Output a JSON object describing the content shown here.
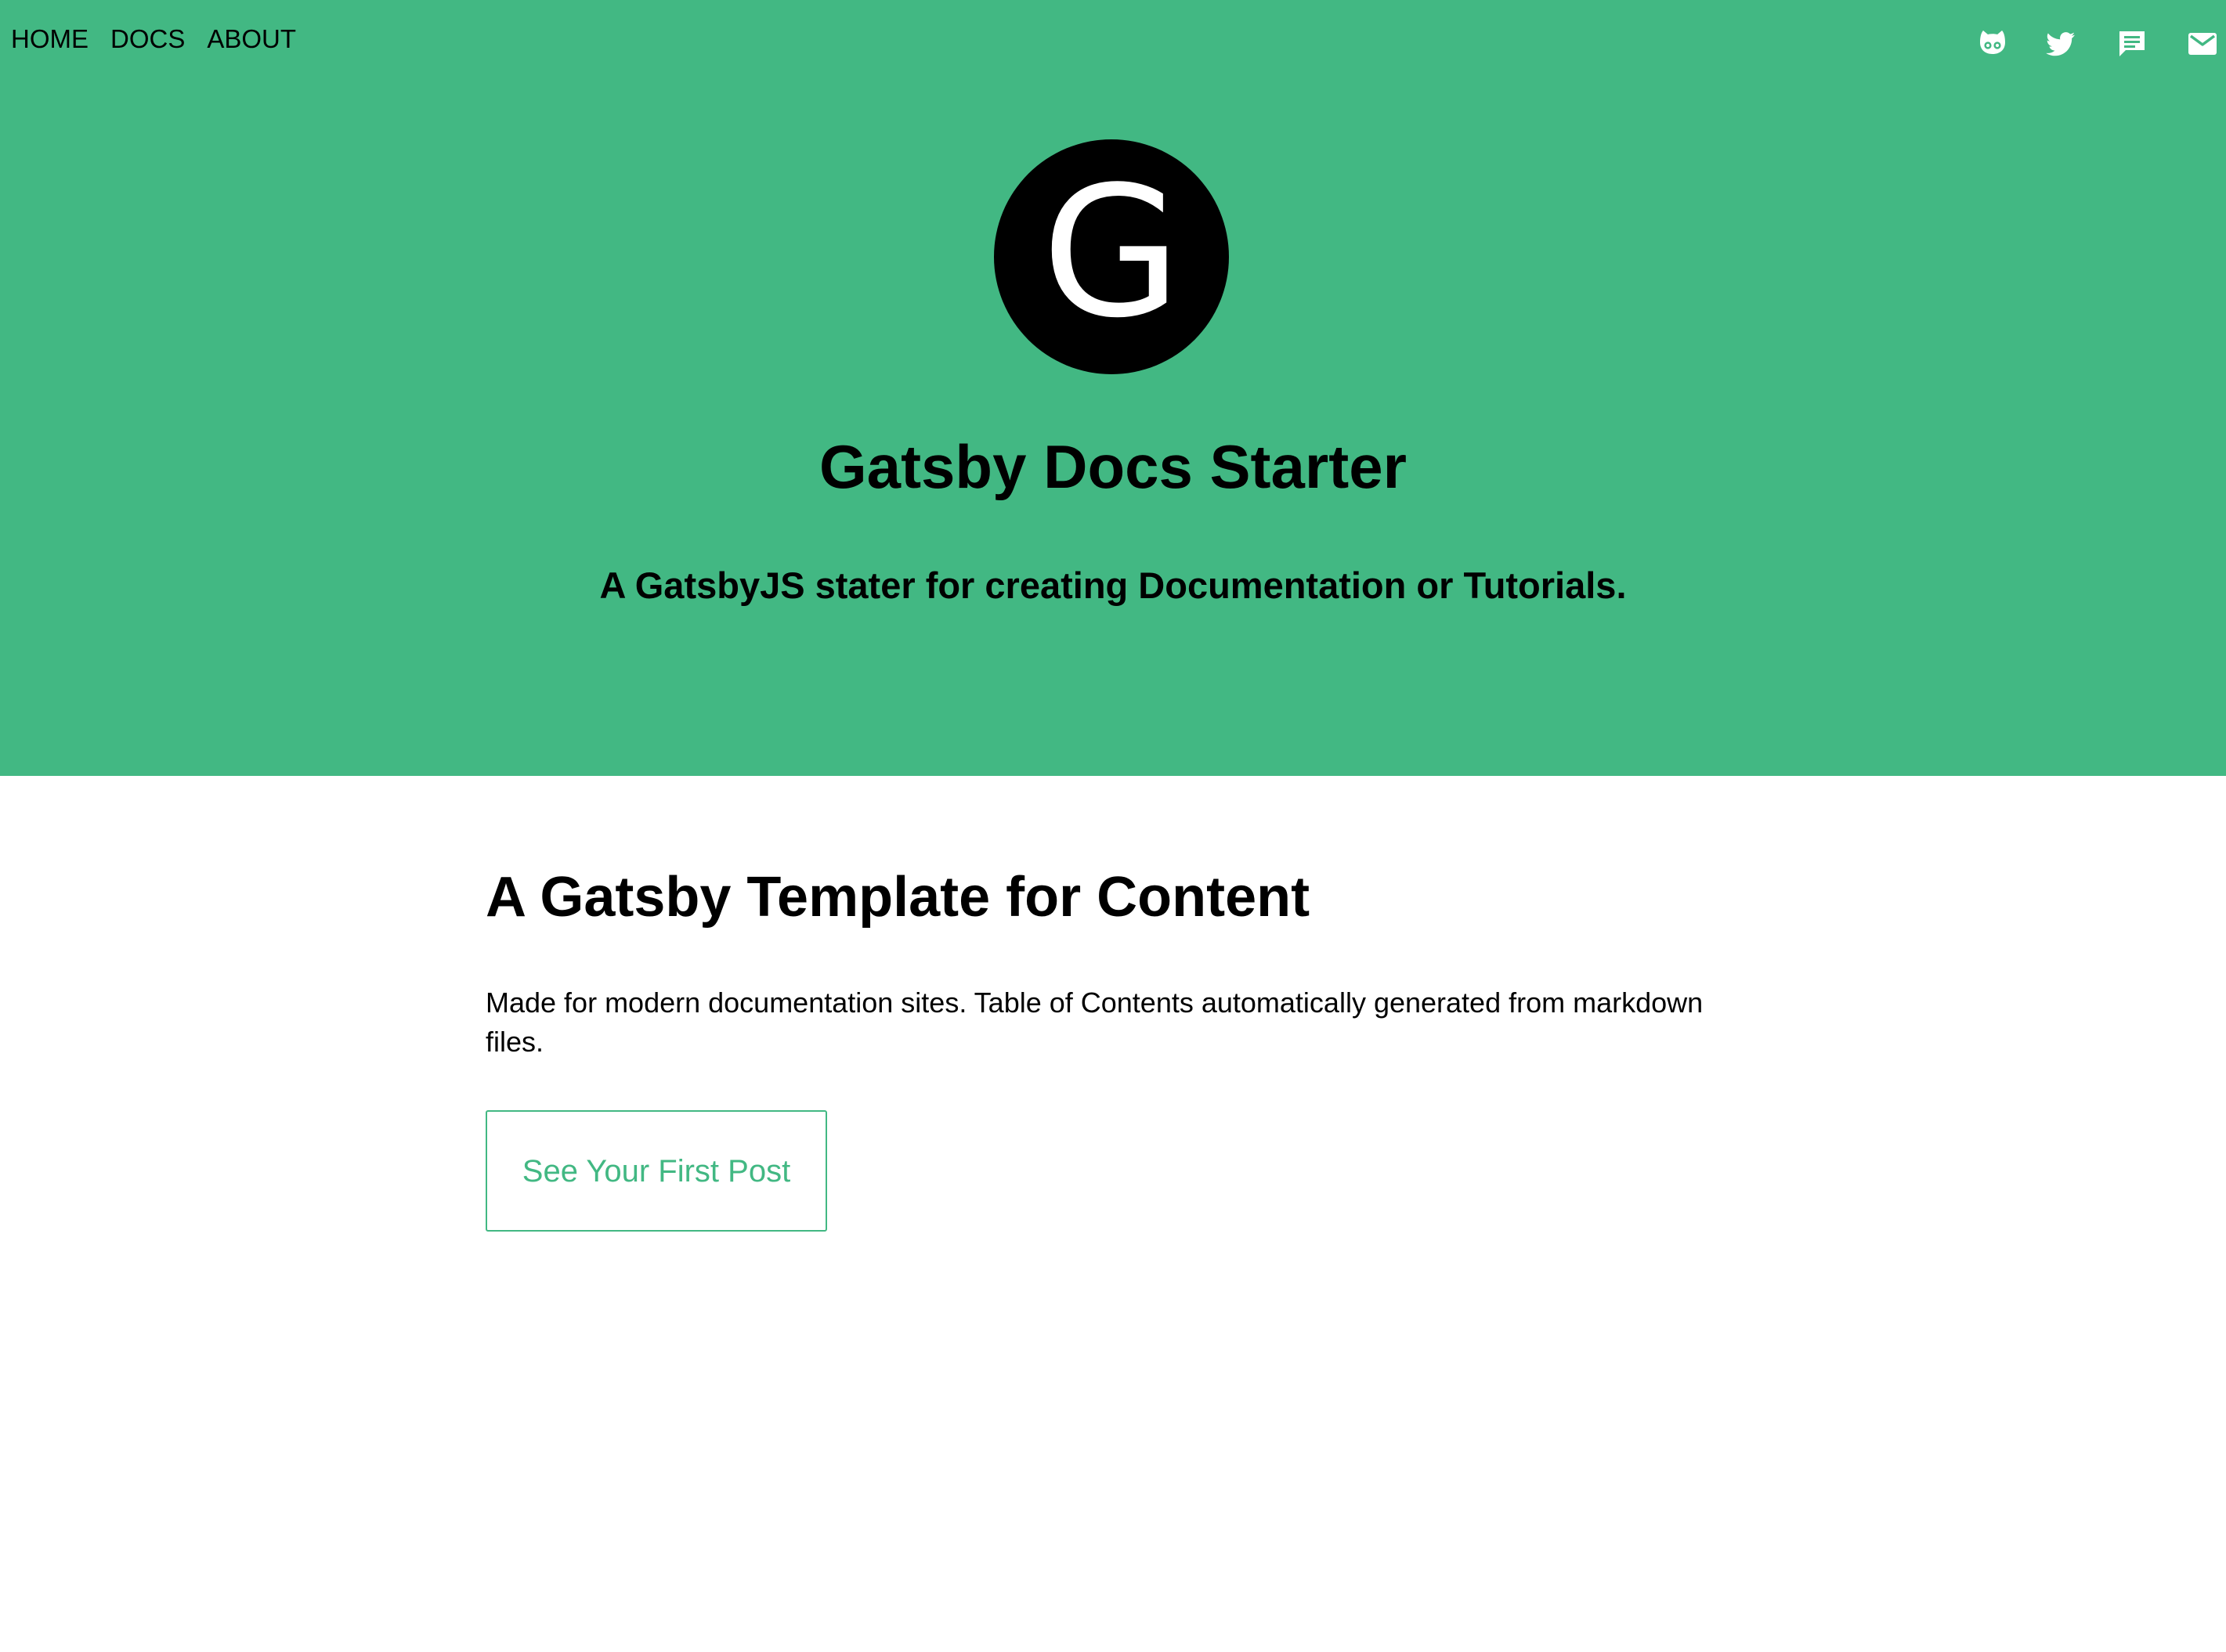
{
  "nav": {
    "items": [
      {
        "label": "HOME"
      },
      {
        "label": "DOCS"
      },
      {
        "label": "ABOUT"
      }
    ]
  },
  "social": {
    "icons": [
      "github-icon",
      "twitter-icon",
      "message-icon",
      "email-icon"
    ]
  },
  "hero": {
    "logo_letter": "G",
    "title": "Gatsby Docs Starter",
    "subtitle": "A GatsbyJS stater for creating Documentation or Tutorials."
  },
  "main": {
    "title": "A Gatsby Template for Content",
    "description": "Made for modern documentation sites. Table of Contents automatically generated from markdown files.",
    "cta_label": "See Your First Post"
  },
  "colors": {
    "accent": "#42b883",
    "text": "#000000",
    "background": "#ffffff",
    "logo_bg": "#000000",
    "logo_text": "#ffffff"
  }
}
